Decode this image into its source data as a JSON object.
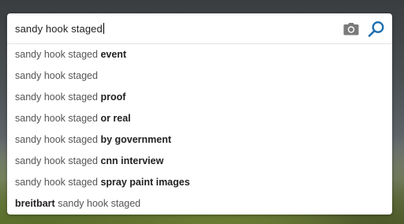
{
  "search": {
    "query": "sandy hook staged"
  },
  "icons": {
    "camera": "camera-icon",
    "search": "search-icon",
    "camera_color": "#7a7a7a",
    "search_color": "#1f6fb0"
  },
  "suggestions": [
    {
      "prefix": "sandy hook staged",
      "bold": "event",
      "bold_first": false
    },
    {
      "prefix": "sandy hook staged",
      "bold": "",
      "bold_first": false
    },
    {
      "prefix": "sandy hook staged",
      "bold": "proof",
      "bold_first": false
    },
    {
      "prefix": "sandy hook staged",
      "bold": "or real",
      "bold_first": false
    },
    {
      "prefix": "sandy hook staged",
      "bold": "by government",
      "bold_first": false
    },
    {
      "prefix": "sandy hook staged",
      "bold": "cnn interview",
      "bold_first": false
    },
    {
      "prefix": "sandy hook staged",
      "bold": "spray paint images",
      "bold_first": false
    },
    {
      "prefix": "sandy hook staged",
      "bold": "breitbart",
      "bold_first": true
    }
  ]
}
